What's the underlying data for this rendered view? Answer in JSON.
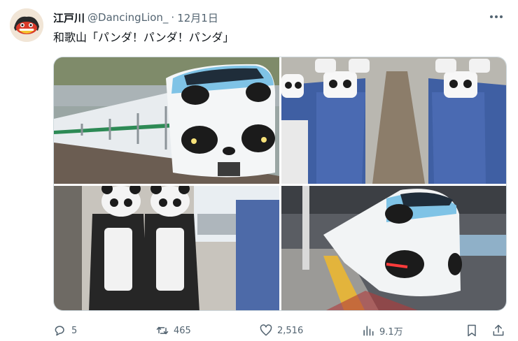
{
  "tweet": {
    "display_name": "江戸川",
    "handle": "@DancingLion_",
    "separator": "·",
    "date": "12月1日",
    "text": "和歌山「パンダ！パンダ！パンダ」"
  },
  "media": [
    {
      "kind": "photo",
      "subject": "panda-train-front"
    },
    {
      "kind": "photo",
      "subject": "panda-headrest-seats"
    },
    {
      "kind": "photo",
      "subject": "panda-green-seats"
    },
    {
      "kind": "photo",
      "subject": "panda-train-platform"
    }
  ],
  "actions": {
    "reply_count": "5",
    "retweet_count": "465",
    "like_count": "2,516",
    "view_count": "9.1万"
  },
  "icons": [
    "avatar-icon",
    "more-icon",
    "reply-icon",
    "retweet-icon",
    "like-icon",
    "views-icon",
    "bookmark-icon",
    "share-icon"
  ],
  "colors": {
    "text": "#0f1419",
    "secondary": "#536471",
    "border": "#cfd9de"
  }
}
